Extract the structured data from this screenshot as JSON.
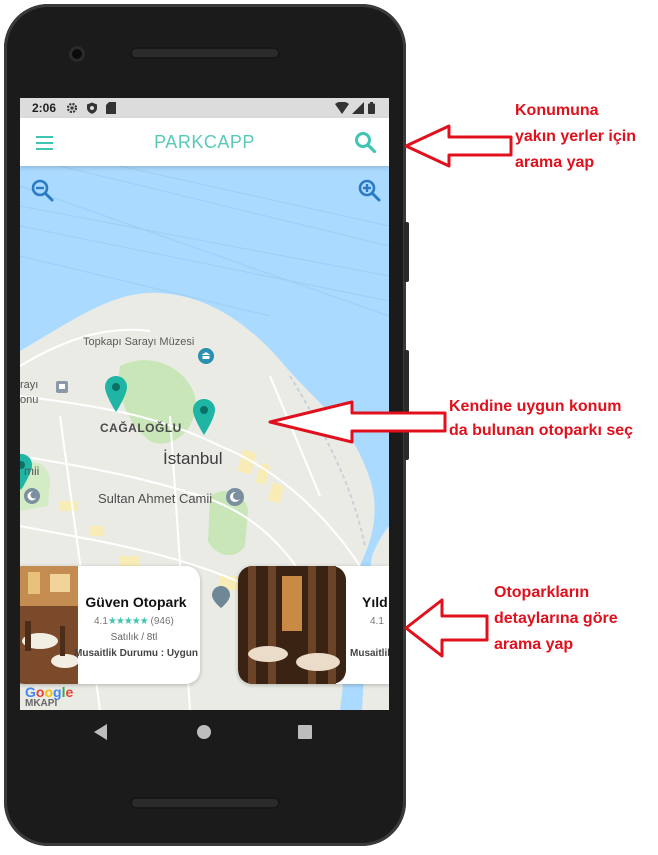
{
  "status_bar": {
    "time": "2:06"
  },
  "app": {
    "title": "PARKCAPP",
    "menu_icon": "hamburger-menu-icon",
    "search_icon": "search-icon",
    "accent_color": "#3fc5b1"
  },
  "map": {
    "labels": {
      "topkapi": "Topkapı Sarayı Müzesi",
      "cagaloglu": "CAĞALOĞLU",
      "istanbul": "İstanbul",
      "sultan_ahmet": "Sultan Ahmet Camii",
      "partial_left_top": "rayı",
      "partial_left_bottom": "onu",
      "partial_left_mid": "mii",
      "google": "Google",
      "partial_bottom": "MKAPI"
    },
    "colors": {
      "water": "#aadaff",
      "land": "#ebebe6",
      "park": "#c8e6b8"
    }
  },
  "cards": [
    {
      "name": "Güven Otopark",
      "rating": "4.1",
      "stars": "★★★★★",
      "reviews": "(946)",
      "subtitle": "Satılık / 8tl",
      "status": "Musaitlik Durumu : Uygun"
    },
    {
      "name": "Yıld",
      "rating": "4.1",
      "status": "Musaitlik"
    }
  ],
  "annotations": {
    "search": [
      "Konumuna",
      "yakın yerler için",
      "arama yap"
    ],
    "select": [
      "Kendine uygun konum",
      "da bulunan otoparkı seç"
    ],
    "details": [
      "Otoparkların",
      "detaylarına göre",
      "arama yap"
    ]
  }
}
